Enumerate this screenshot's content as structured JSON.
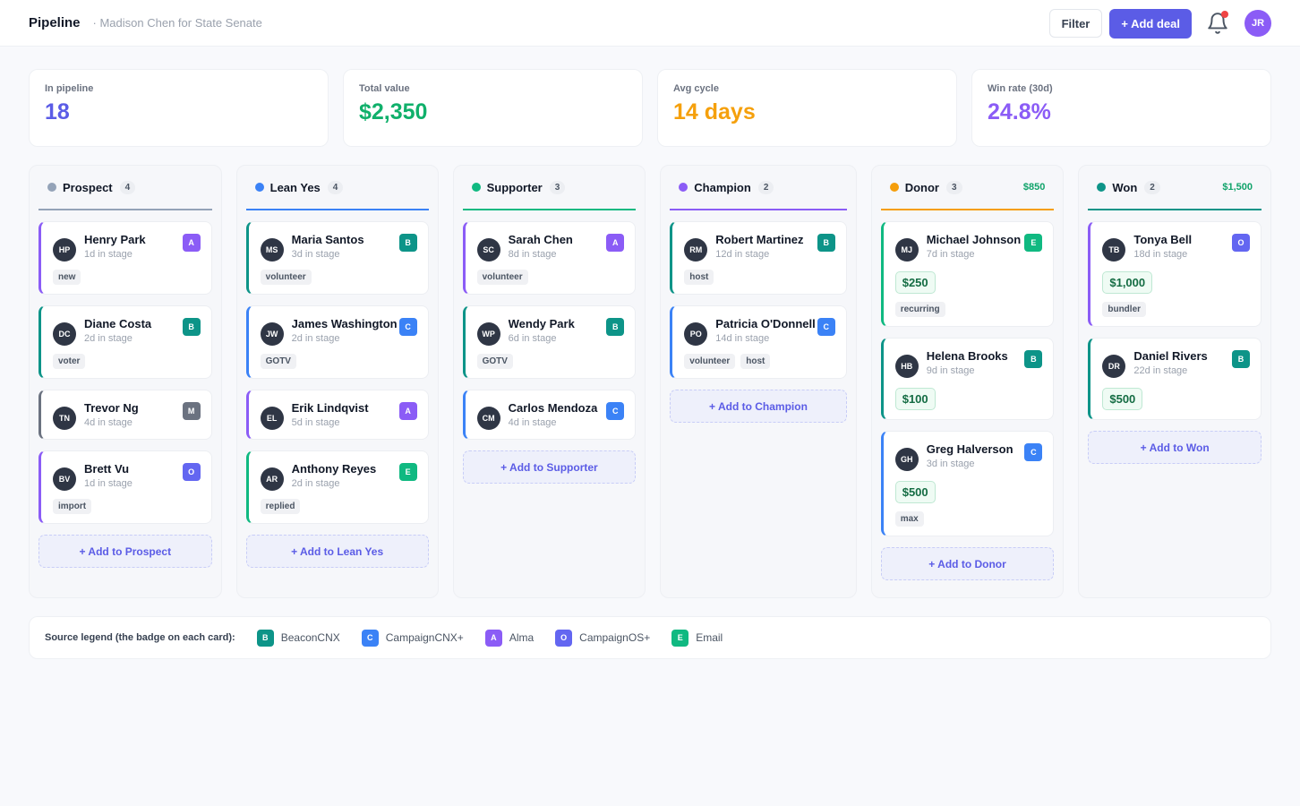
{
  "header": {
    "title": "Pipeline",
    "subtitle": "· Madison Chen for State Senate",
    "filter_label": "Filter",
    "add_deal_label": "+ Add deal",
    "user_initials": "JR"
  },
  "stats": [
    {
      "label": "In pipeline",
      "value": "18",
      "color": "#5b5ce6"
    },
    {
      "label": "Total value",
      "value": "$2,350",
      "color": "#10b06b"
    },
    {
      "label": "Avg cycle",
      "value": "14 days",
      "color": "#f5a00c"
    },
    {
      "label": "Win rate (30d)",
      "value": "24.8%",
      "color": "#8b5cf6"
    }
  ],
  "sources": {
    "B": {
      "color": "#0d9488",
      "label": "BeaconCNX"
    },
    "C": {
      "color": "#3b82f6",
      "label": "CampaignCNX+"
    },
    "A": {
      "color": "#8b5cf6",
      "label": "Alma"
    },
    "O": {
      "color": "#6366f1",
      "label": "CampaignOS+"
    },
    "E": {
      "color": "#10b981",
      "label": "Email"
    },
    "M": {
      "color": "#6b7280",
      "label": ""
    }
  },
  "columns": [
    {
      "name": "Prospect",
      "count": "4",
      "total": "",
      "color": "#94a3b8",
      "add_label": "+ Add to Prospect",
      "cards": [
        {
          "initials": "HP",
          "name": "Henry Park",
          "stage": "1d in stage",
          "source": "A",
          "amount": "",
          "tags": [
            "new"
          ],
          "accent": "#8b5cf6"
        },
        {
          "initials": "DC",
          "name": "Diane Costa",
          "stage": "2d in stage",
          "source": "B",
          "amount": "",
          "tags": [
            "voter"
          ],
          "accent": "#0d9488"
        },
        {
          "initials": "TN",
          "name": "Trevor Ng",
          "stage": "4d in stage",
          "source": "M",
          "amount": "",
          "tags": [],
          "accent": "#6b7280"
        },
        {
          "initials": "BV",
          "name": "Brett Vu",
          "stage": "1d in stage",
          "source": "O",
          "amount": "",
          "tags": [
            "import"
          ],
          "accent": "#8b5cf6"
        }
      ]
    },
    {
      "name": "Lean Yes",
      "count": "4",
      "total": "",
      "color": "#3b82f6",
      "add_label": "+ Add to Lean Yes",
      "cards": [
        {
          "initials": "MS",
          "name": "Maria Santos",
          "stage": "3d in stage",
          "source": "B",
          "amount": "",
          "tags": [
            "volunteer"
          ],
          "accent": "#0d9488"
        },
        {
          "initials": "JW",
          "name": "James Washington",
          "stage": "2d in stage",
          "source": "C",
          "amount": "",
          "tags": [
            "GOTV"
          ],
          "accent": "#3b82f6"
        },
        {
          "initials": "EL",
          "name": "Erik Lindqvist",
          "stage": "5d in stage",
          "source": "A",
          "amount": "",
          "tags": [],
          "accent": "#8b5cf6"
        },
        {
          "initials": "AR",
          "name": "Anthony Reyes",
          "stage": "2d in stage",
          "source": "E",
          "amount": "",
          "tags": [
            "replied"
          ],
          "accent": "#10b981"
        }
      ]
    },
    {
      "name": "Supporter",
      "count": "3",
      "total": "",
      "color": "#10b981",
      "add_label": "+ Add to Supporter",
      "cards": [
        {
          "initials": "SC",
          "name": "Sarah Chen",
          "stage": "8d in stage",
          "source": "A",
          "amount": "",
          "tags": [
            "volunteer"
          ],
          "accent": "#8b5cf6"
        },
        {
          "initials": "WP",
          "name": "Wendy Park",
          "stage": "6d in stage",
          "source": "B",
          "amount": "",
          "tags": [
            "GOTV"
          ],
          "accent": "#0d9488"
        },
        {
          "initials": "CM",
          "name": "Carlos Mendoza",
          "stage": "4d in stage",
          "source": "C",
          "amount": "",
          "tags": [],
          "accent": "#3b82f6"
        }
      ]
    },
    {
      "name": "Champion",
      "count": "2",
      "total": "",
      "color": "#8b5cf6",
      "add_label": "+ Add to Champion",
      "cards": [
        {
          "initials": "RM",
          "name": "Robert Martinez",
          "stage": "12d in stage",
          "source": "B",
          "amount": "",
          "tags": [
            "host"
          ],
          "accent": "#0d9488"
        },
        {
          "initials": "PO",
          "name": "Patricia O'Donnell",
          "stage": "14d in stage",
          "source": "C",
          "amount": "",
          "tags": [
            "volunteer",
            "host"
          ],
          "accent": "#3b82f6"
        }
      ]
    },
    {
      "name": "Donor",
      "count": "3",
      "total": "$850",
      "color": "#f59e0b",
      "add_label": "+ Add to Donor",
      "cards": [
        {
          "initials": "MJ",
          "name": "Michael Johnson",
          "stage": "7d in stage",
          "source": "E",
          "amount": "$250",
          "tags": [
            "recurring"
          ],
          "accent": "#10b981"
        },
        {
          "initials": "HB",
          "name": "Helena Brooks",
          "stage": "9d in stage",
          "source": "B",
          "amount": "$100",
          "tags": [],
          "accent": "#0d9488"
        },
        {
          "initials": "GH",
          "name": "Greg Halverson",
          "stage": "3d in stage",
          "source": "C",
          "amount": "$500",
          "tags": [
            "max"
          ],
          "accent": "#3b82f6"
        }
      ]
    },
    {
      "name": "Won",
      "count": "2",
      "total": "$1,500",
      "color": "#0d9488",
      "add_label": "+ Add to Won",
      "cards": [
        {
          "initials": "TB",
          "name": "Tonya Bell",
          "stage": "18d in stage",
          "source": "O",
          "amount": "$1,000",
          "tags": [
            "bundler"
          ],
          "accent": "#8b5cf6"
        },
        {
          "initials": "DR",
          "name": "Daniel Rivers",
          "stage": "22d in stage",
          "source": "B",
          "amount": "$500",
          "tags": [],
          "accent": "#0d9488"
        }
      ]
    }
  ],
  "legend": {
    "title": "Source legend (the badge on each card):",
    "items": [
      {
        "badge": "B",
        "label": "BeaconCNX",
        "color": "#0d9488"
      },
      {
        "badge": "C",
        "label": "CampaignCNX+",
        "color": "#3b82f6"
      },
      {
        "badge": "A",
        "label": "Alma",
        "color": "#8b5cf6"
      },
      {
        "badge": "O",
        "label": "CampaignOS+",
        "color": "#6366f1"
      },
      {
        "badge": "E",
        "label": "Email",
        "color": "#10b981"
      }
    ]
  }
}
